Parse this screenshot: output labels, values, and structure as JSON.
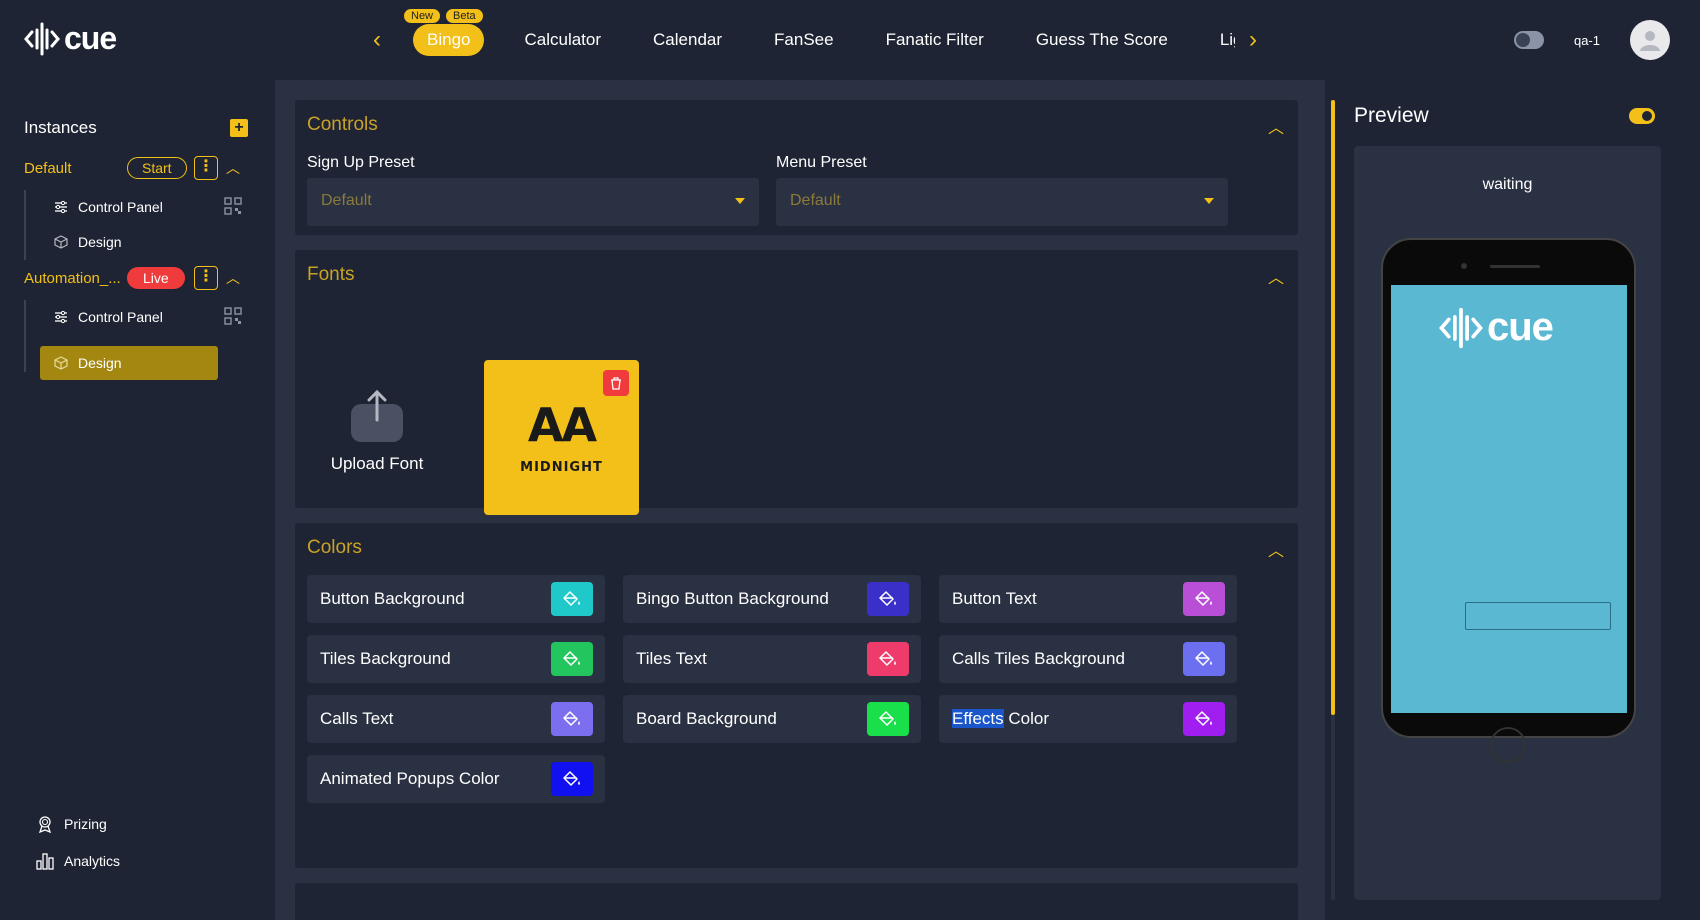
{
  "app": {
    "logo_text": "cue",
    "user_name": "qa-1"
  },
  "nav": {
    "tabs": [
      {
        "label": "Bingo",
        "badges": [
          "New",
          "Beta"
        ],
        "active": true
      },
      {
        "label": "Calculator"
      },
      {
        "label": "Calendar"
      },
      {
        "label": "FanSee"
      },
      {
        "label": "Fanatic Filter"
      },
      {
        "label": "Guess The Score"
      },
      {
        "label": "Lig"
      }
    ]
  },
  "sidebar": {
    "title": "Instances",
    "instances": [
      {
        "name": "Default",
        "status": "Start",
        "children": [
          "Control Panel",
          "Design"
        ]
      },
      {
        "name": "Automation_...",
        "status": "Live",
        "children": [
          "Control Panel",
          "Design"
        ],
        "active_child": "Design"
      }
    ],
    "bottom_links": [
      "Prizing",
      "Analytics"
    ]
  },
  "controls": {
    "title": "Controls",
    "fields": [
      {
        "label": "Sign Up Preset",
        "value": "Default"
      },
      {
        "label": "Menu Preset",
        "value": "Default"
      }
    ]
  },
  "fonts": {
    "title": "Fonts",
    "upload_label": "Upload Font",
    "font_card": {
      "preview": "AA",
      "name": "MIDNIGHT"
    }
  },
  "colors": {
    "title": "Colors",
    "items": [
      {
        "label": "Button Background",
        "color": "#1fc9c9"
      },
      {
        "label": "Bingo Button Background",
        "color": "#3a2fc9"
      },
      {
        "label": "Button Text",
        "color": "#b94fd6"
      },
      {
        "label": "Tiles Background",
        "color": "#22c55e"
      },
      {
        "label": "Tiles Text",
        "color": "#ef3b6b"
      },
      {
        "label": "Calls Tiles Background",
        "color": "#6b6ff0"
      },
      {
        "label": "Calls Text",
        "color": "#7b6ff0"
      },
      {
        "label": "Board Background",
        "color": "#19e04a"
      },
      {
        "label": "Effects",
        "label_rest": " Color",
        "color": "#a01ef0"
      },
      {
        "label": "Animated Popups Color",
        "color": "#1010f0"
      }
    ]
  },
  "preview": {
    "title": "Preview",
    "status": "waiting"
  },
  "colors_theme": {
    "accent": "#f2c018",
    "live": "#ef3b3b",
    "bg": "#1e2433",
    "panel": "#2a3142"
  }
}
